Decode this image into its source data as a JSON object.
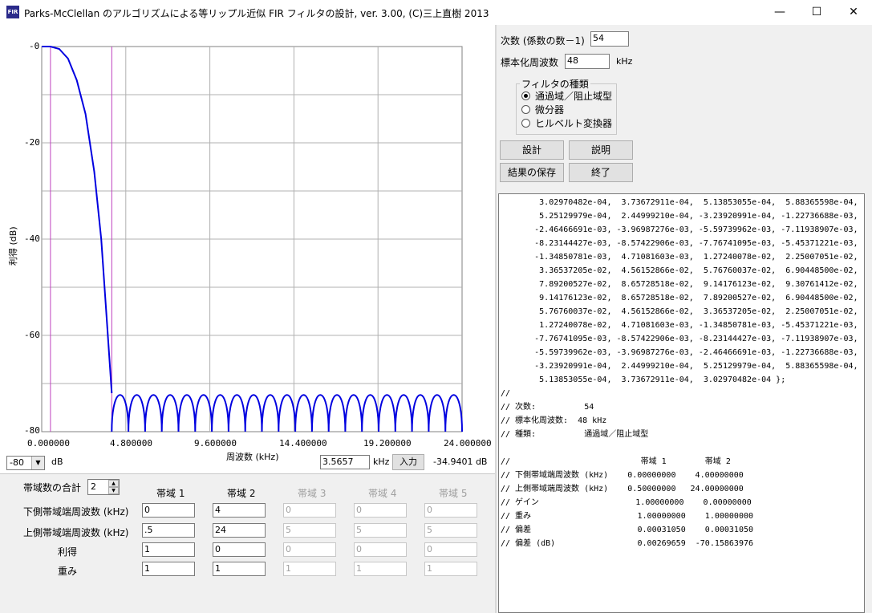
{
  "window": {
    "title": "Parks-McClellan のアルゴリズムによる等リップル近似 FIR フィルタの設計,   ver. 3.00,  (C)三上直樹 2013",
    "icon_label": "FIR",
    "minimize_icon": "minimize-icon",
    "maximize_icon": "maximize-icon",
    "close_icon": "close-icon"
  },
  "chart": {
    "ylabel": "利得 (dB)",
    "xlabel": "周波数 (kHz)",
    "yticks": [
      "-0",
      "-20",
      "-40",
      "-60",
      "-80"
    ],
    "xticks": [
      "0.000000",
      "4.800000",
      "9.600000",
      "14.400000",
      "19.200000",
      "24.000000"
    ]
  },
  "chart_data": {
    "type": "line",
    "xlabel": "周波数 (kHz)",
    "ylabel": "利得 (dB)",
    "xlim": [
      0,
      24
    ],
    "ylim": [
      -80,
      0
    ],
    "grid": true,
    "markers_x": [
      0.5,
      4.0
    ],
    "stopband_level_db": -70.15863976,
    "stopband_ripples": 21,
    "series": [
      {
        "x": [
          0,
          0.5,
          1.0,
          1.5,
          2.0,
          2.5,
          3.0,
          3.4,
          3.7,
          4.0
        ],
        "y": [
          0,
          0,
          -0.5,
          -2.5,
          -7,
          -14,
          -26,
          -40,
          -56,
          -72
        ]
      }
    ],
    "color": "#0000e0"
  },
  "controls": {
    "db_combo_value": "-80",
    "db_unit": "dB",
    "freq_input_value": "3.5657",
    "freq_unit": "kHz",
    "input_button": "入力",
    "readout": "-34.9401 dB"
  },
  "bands": {
    "total_label": "帯域数の合計",
    "total_value": "2",
    "headers": [
      "帯域 1",
      "帯域 2",
      "帯域 3",
      "帯域 4",
      "帯域 5"
    ],
    "rows": [
      {
        "label": "下側帯域端周波数 (kHz)",
        "values": [
          "0",
          "4",
          "0",
          "0",
          "0"
        ]
      },
      {
        "label": "上側帯域端周波数 (kHz)",
        "values": [
          ".5",
          "24",
          "5",
          "5",
          "5"
        ]
      },
      {
        "label": "利得",
        "values": [
          "1",
          "0",
          "0",
          "0",
          "0"
        ]
      },
      {
        "label": "重み",
        "values": [
          "1",
          "1",
          "1",
          "1",
          "1"
        ]
      }
    ]
  },
  "right": {
    "order_label": "次数 (係数の数－1)",
    "order_value": "54",
    "fs_label": "標本化周波数",
    "fs_value": "48",
    "fs_unit": "kHz",
    "group_title": "フィルタの種類",
    "radios": [
      "通過域／阻止域型",
      "微分器",
      "ヒルベルト変換器"
    ],
    "buttons": {
      "design": "設計",
      "explain": "説明",
      "save": "結果の保存",
      "exit": "終了"
    }
  },
  "output_text": "        3.02970482e-04,  3.73672911e-04,  5.13853055e-04,  5.88365598e-04,\n        5.25129979e-04,  2.44999210e-04, -3.23920991e-04, -1.22736688e-03,\n       -2.46466691e-03, -3.96987276e-03, -5.59739962e-03, -7.11938907e-03,\n       -8.23144427e-03, -8.57422906e-03, -7.76741095e-03, -5.45371221e-03,\n       -1.34850781e-03,  4.71081603e-03,  1.27240078e-02,  2.25007051e-02,\n        3.36537205e-02,  4.56152866e-02,  5.76760037e-02,  6.90448500e-02,\n        7.89200527e-02,  8.65728518e-02,  9.14176123e-02,  9.30761412e-02,\n        9.14176123e-02,  8.65728518e-02,  7.89200527e-02,  6.90448500e-02,\n        5.76760037e-02,  4.56152866e-02,  3.36537205e-02,  2.25007051e-02,\n        1.27240078e-02,  4.71081603e-03, -1.34850781e-03, -5.45371221e-03,\n       -7.76741095e-03, -8.57422906e-03, -8.23144427e-03, -7.11938907e-03,\n       -5.59739962e-03, -3.96987276e-03, -2.46466691e-03, -1.22736688e-03,\n       -3.23920991e-04,  2.44999210e-04,  5.25129979e-04,  5.88365598e-04,\n        5.13853055e-04,  3.73672911e-04,  3.02970482e-04 };\n//\n// 次数:          54\n// 標本化周波数:  48 kHz\n// 種類:          通過域／阻止域型\n\n//                           帯域 1        帯域 2\n// 下側帯域端周波数 (kHz)    0.00000000    4.00000000\n// 上側帯域端周波数 (kHz)    0.50000000   24.00000000\n// ゲイン                    1.00000000    0.00000000\n// 重み                      1.00000000    1.00000000\n// 偏差                      0.00031050    0.00031050\n// 偏差 (dB)                 0.00269659  -70.15863976"
}
